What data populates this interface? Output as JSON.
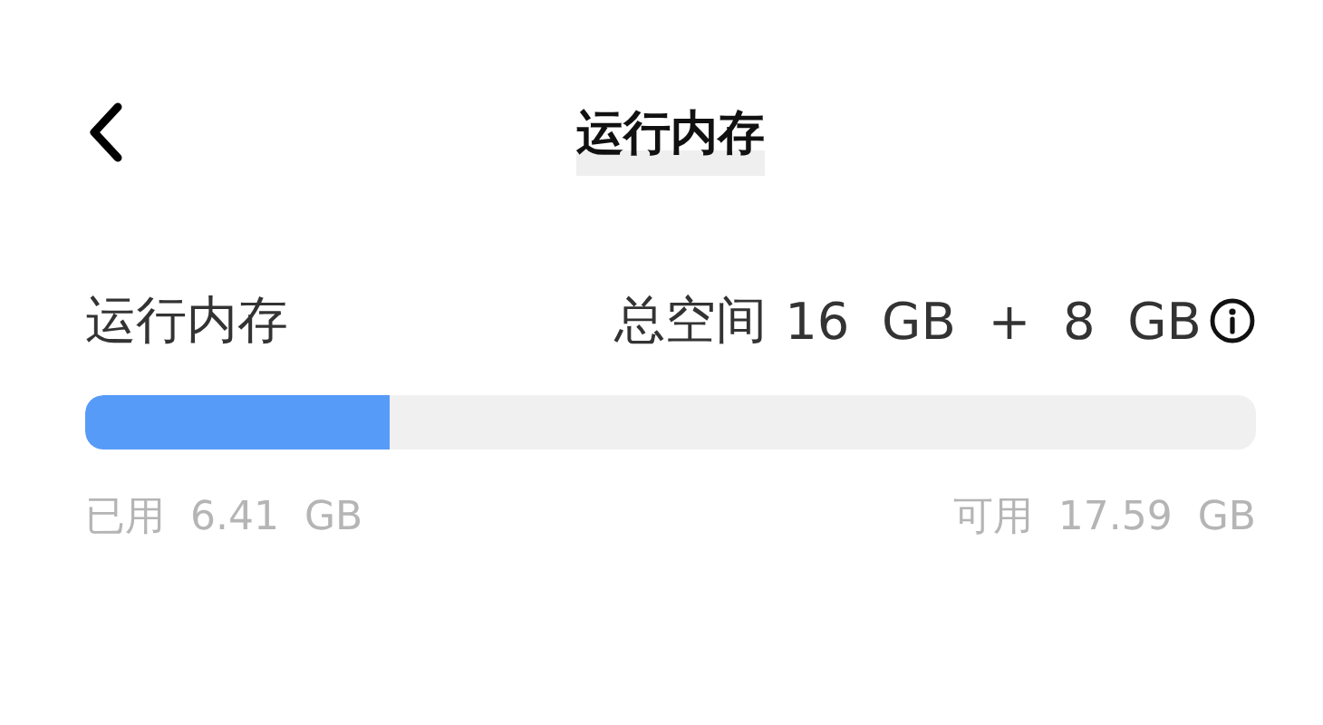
{
  "header": {
    "title": "运行内存"
  },
  "memory": {
    "label": "运行内存",
    "total_label": "总空间",
    "total_value": "16  GB  +  8  GB",
    "level": 0.26,
    "used": "已用  6.41  GB",
    "available": "可用  17.59  GB"
  }
}
